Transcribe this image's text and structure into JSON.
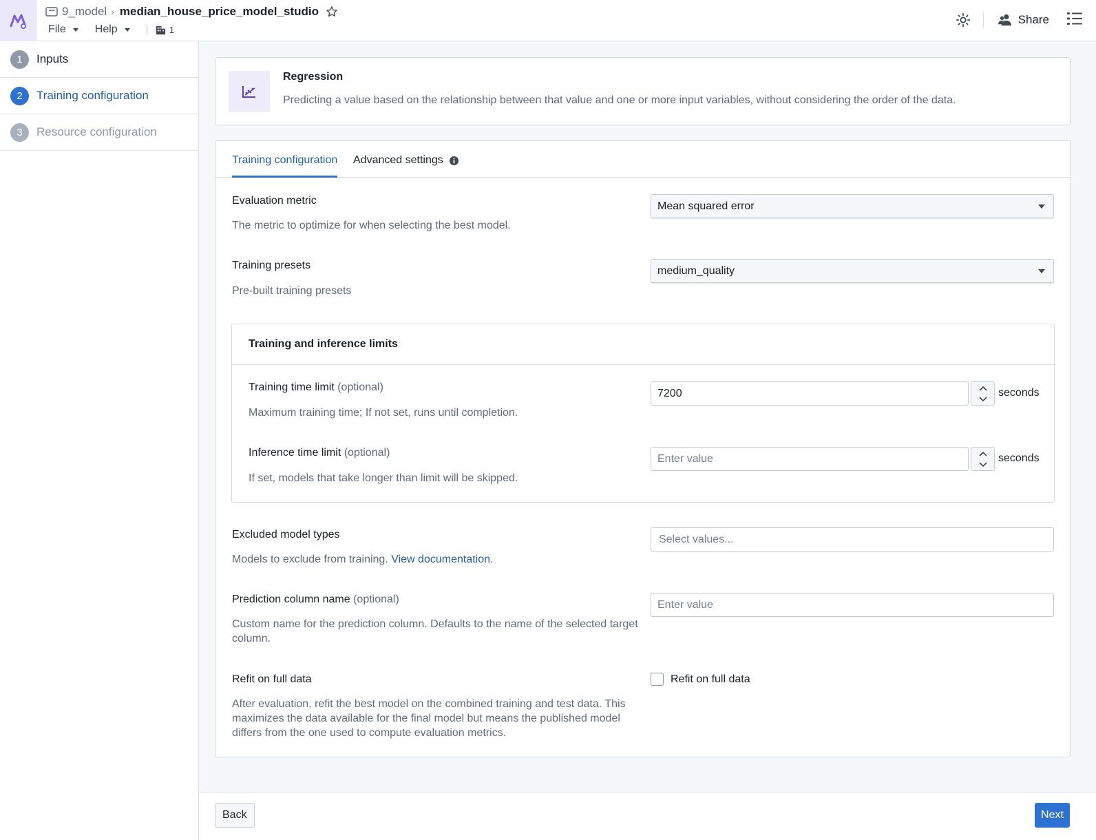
{
  "header": {
    "breadcrumb_parent": "9_model",
    "breadcrumb_current": "median_house_price_model_studio",
    "menu_file": "File",
    "menu_help": "Help",
    "org_count": "1",
    "share_label": "Share"
  },
  "sidebar": {
    "steps": [
      {
        "number": "1",
        "label": "Inputs",
        "state": "done"
      },
      {
        "number": "2",
        "label": "Training configuration",
        "state": "active"
      },
      {
        "number": "3",
        "label": "Resource configuration",
        "state": "pending"
      }
    ]
  },
  "summary": {
    "title": "Regression",
    "description": "Predicting a value based on the relationship between that value and one or more input variables, without considering the order of the data."
  },
  "tabs": {
    "training": "Training configuration",
    "advanced": "Advanced settings"
  },
  "form": {
    "evaluation_metric": {
      "label": "Evaluation metric",
      "help": "The metric to optimize for when selecting the best model.",
      "value": "Mean squared error"
    },
    "training_presets": {
      "label": "Training presets",
      "help": "Pre-built training presets",
      "value": "medium_quality"
    },
    "limits": {
      "title": "Training and inference limits",
      "training_time": {
        "label": "Training time limit",
        "optional": "(optional)",
        "help": "Maximum training time; If not set, runs until completion.",
        "value": "7200",
        "unit": "seconds"
      },
      "inference_time": {
        "label": "Inference time limit",
        "optional": "(optional)",
        "help": "If set, models that take longer than limit will be skipped.",
        "placeholder": "Enter value",
        "unit": "seconds"
      }
    },
    "excluded_models": {
      "label": "Excluded model types",
      "help_prefix": "Models to exclude from training. ",
      "help_link": "View documentation",
      "help_suffix": ".",
      "placeholder": "Select values..."
    },
    "prediction_column": {
      "label": "Prediction column name",
      "optional": "(optional)",
      "help_line1": "Custom name for the prediction column. Defaults to the name of the selected target",
      "help_line2": "column.",
      "placeholder": "Enter value"
    },
    "refit": {
      "label": "Refit on full data",
      "help_line1": "After evaluation, refit the best model on the combined training and test data. This",
      "help_line2": "maximizes the data available for the final model but means the published model",
      "help_line3": "differs from the one used to compute evaluation metrics.",
      "checkbox_label": "Refit on full data",
      "checked": false
    }
  },
  "footer": {
    "back": "Back",
    "next": "Next"
  },
  "colors": {
    "accent": "#2d72d2",
    "link": "#215db0",
    "brand_tint": "#ece8fb"
  }
}
